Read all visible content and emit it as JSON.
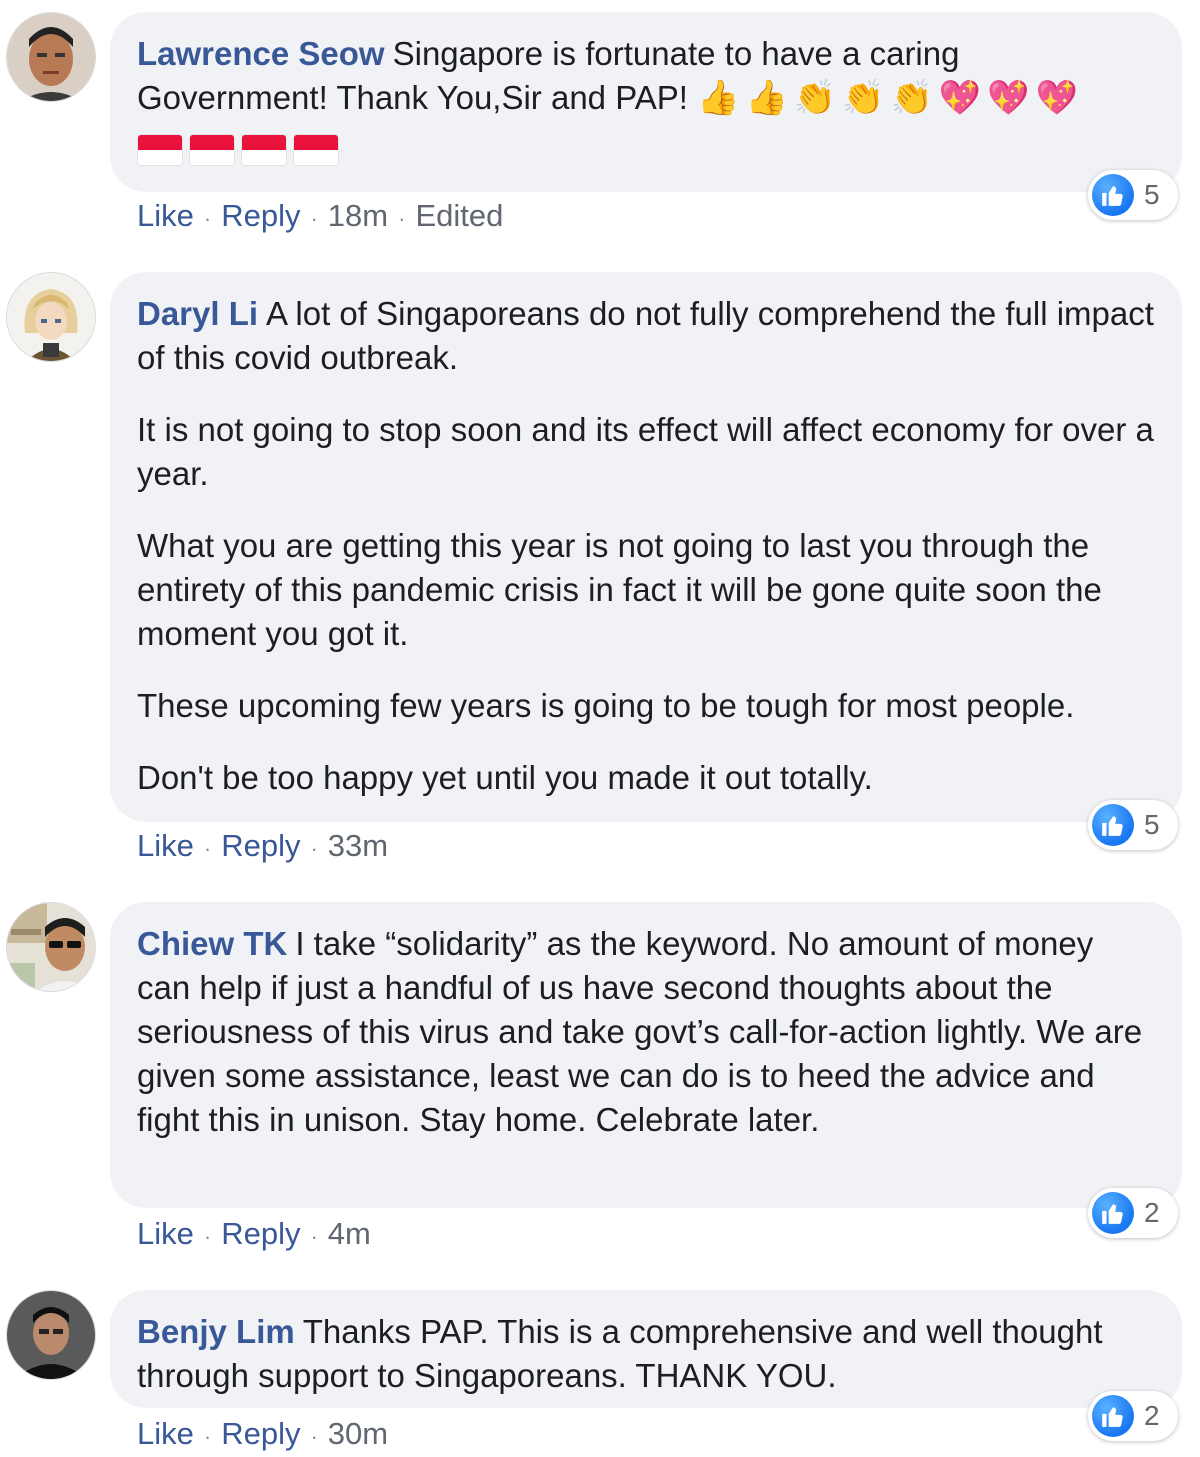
{
  "comments": [
    {
      "author": "Lawrence Seow",
      "paragraphs": [
        "Singapore is fortunate to have a caring Government! Thank You,Sir and PAP!"
      ],
      "emojis": [
        "👍",
        "👍",
        "👏",
        "👏",
        "👏",
        "💖",
        "💖",
        "💖"
      ],
      "flags": [
        "🇸🇬",
        "🇸🇬",
        "🇸🇬",
        "🇸🇬"
      ],
      "actions": {
        "like": "Like",
        "reply": "Reply",
        "time": "18m",
        "edited": "Edited"
      },
      "reactions": "5"
    },
    {
      "author": "Daryl Li",
      "paragraphs": [
        "A lot of Singaporeans do not fully comprehend the full impact of this covid outbreak.",
        "It is not going to stop soon and its effect will affect economy for over a year.",
        "What you are getting this year is not going to last you through the entirety of this pandemic crisis in fact it will be gone quite soon the moment you got it.",
        "These upcoming few years is going to be tough for most people.",
        "Don't be too happy yet until you made it out totally."
      ],
      "actions": {
        "like": "Like",
        "reply": "Reply",
        "time": "33m"
      },
      "reactions": "5"
    },
    {
      "author": "Chiew TK",
      "paragraphs": [
        "I take “solidarity” as the keyword. No amount of money can help if just a handful of us have second thoughts about the seriousness of this virus and take govt’s call-for-action lightly. We are given some assistance, least we can do is to heed the advice and fight this in unison. Stay home. Celebrate later."
      ],
      "actions": {
        "like": "Like",
        "reply": "Reply",
        "time": "4m"
      },
      "reactions": "2"
    },
    {
      "author": "Benjy Lim",
      "paragraphs": [
        "Thanks PAP. This is a comprehensive and well thought through support to Singaporeans. THANK YOU."
      ],
      "actions": {
        "like": "Like",
        "reply": "Reply",
        "time": "30m"
      },
      "reactions": "2"
    }
  ],
  "colors": {
    "author": "#385898",
    "bubble": "#f0f2f5",
    "like": "#1877f2"
  },
  "icons": [
    "avatar",
    "like-reaction-icon",
    "thumbs-up-emoji",
    "clapping-hands-emoji",
    "sparkling-heart-emoji",
    "singapore-flag-emoji"
  ]
}
